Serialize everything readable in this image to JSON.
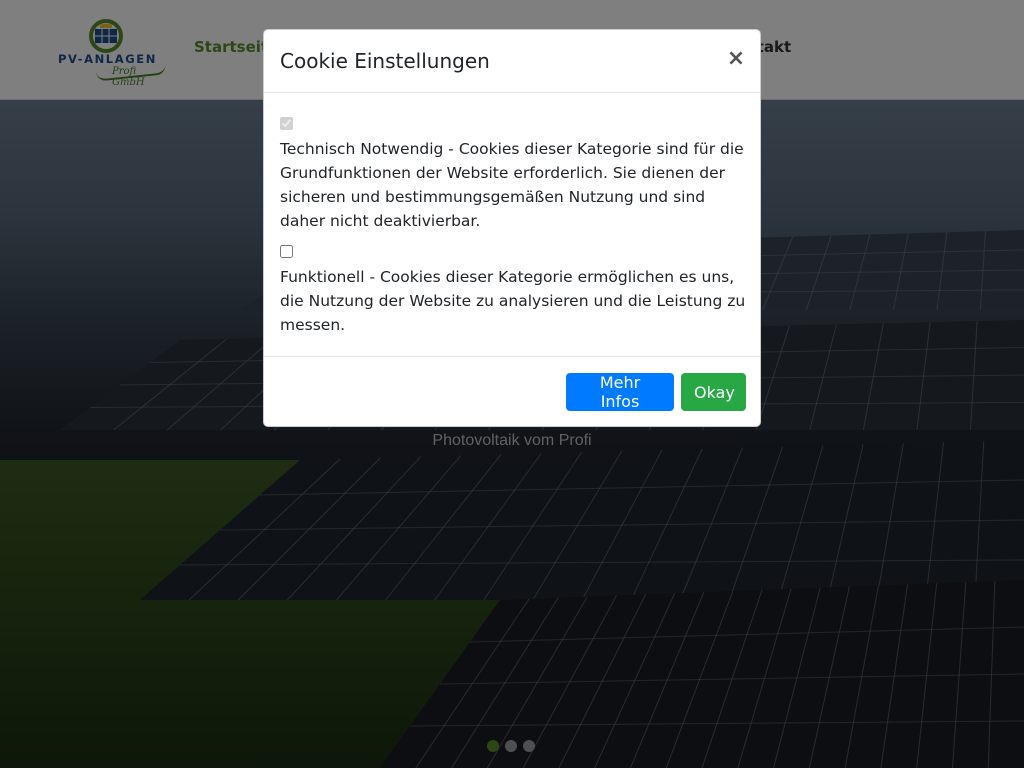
{
  "header": {
    "logo": {
      "name": "PV-ANLAGEN",
      "subtitle": "Profi GmbH"
    },
    "nav": [
      {
        "label": "Startseite",
        "active": true
      },
      {
        "label": "Kontakt",
        "active": false,
        "visible_text": "ntakt"
      }
    ]
  },
  "hero": {
    "subtitle": "Photovoltaik vom Profi",
    "slides": 3,
    "active_slide": 1
  },
  "cookie_modal": {
    "title": "Cookie Einstellungen",
    "close_label": "×",
    "options": [
      {
        "label": "Technisch Notwendig - Cookies dieser Kategorie sind für die Grundfunktionen der Website erforderlich. Sie dienen der sicheren und bestimmungsgemäßen Nutzung und sind daher nicht deaktivierbar.",
        "checked": true,
        "disabled": true
      },
      {
        "label": "Funktionell - Cookies dieser Kategorie ermöglichen es uns, die Nutzung der Website zu analysieren und die Leistung zu messen.",
        "checked": false,
        "disabled": false
      }
    ],
    "buttons": {
      "more_info": "Mehr Infos",
      "okay": "Okay"
    }
  },
  "colors": {
    "brand_green": "#5a8c2d",
    "brand_blue": "#1f4f8f",
    "primary_button": "#007bff",
    "success_button": "#28a745"
  }
}
